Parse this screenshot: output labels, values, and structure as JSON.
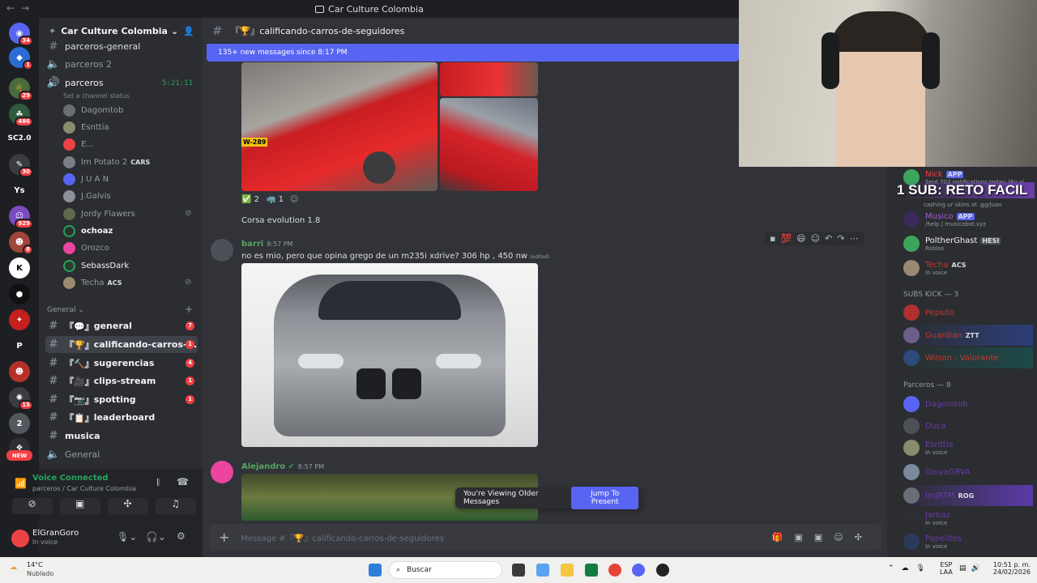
{
  "window": {
    "title": "Car Culture Colombia"
  },
  "server": {
    "name": "Car Culture Colombia"
  },
  "rail_badges": [
    "34",
    "1",
    "29",
    "486",
    "SC2.0",
    "30",
    "Ys",
    "929",
    "8",
    "",
    "P",
    "",
    "15",
    "2",
    "NEW"
  ],
  "channels_top": [
    {
      "name": "parceros-general"
    },
    {
      "name": "parceros 2"
    }
  ],
  "voice_channel": {
    "name": "parceros",
    "timer": "5:21:11",
    "status": "Set a channel status"
  },
  "voice_users": [
    {
      "name": "Dagomtob",
      "tag": ""
    },
    {
      "name": "Esnttia",
      "tag": ""
    },
    {
      "name": "E...",
      "tag": ""
    },
    {
      "name": "Im Potato 2",
      "tag": "CARS"
    },
    {
      "name": "J U A N",
      "tag": ""
    },
    {
      "name": "J.Galvis",
      "tag": ""
    },
    {
      "name": "Jordy Flawers",
      "tag": ""
    },
    {
      "name": "ochoaz",
      "tag": ""
    },
    {
      "name": "Orozco",
      "tag": ""
    },
    {
      "name": "SebassDark",
      "tag": ""
    },
    {
      "name": "Techa",
      "tag": "ACS"
    }
  ],
  "category": "General",
  "channels": [
    {
      "name": "general",
      "prefix": "『💬』",
      "badge": "7"
    },
    {
      "name": "calificando-carros-...",
      "prefix": "『🏆』",
      "badge": "1"
    },
    {
      "name": "sugerencias",
      "prefix": "『🔨』",
      "badge": "4"
    },
    {
      "name": "clips-stream",
      "prefix": "『🎥』",
      "badge": "1"
    },
    {
      "name": "spotting",
      "prefix": "『📷』",
      "badge": "1"
    },
    {
      "name": "leaderboard",
      "prefix": "『📋』",
      "badge": ""
    },
    {
      "name": "musica",
      "prefix": "",
      "badge": ""
    },
    {
      "name": "General",
      "prefix": "",
      "badge": ""
    }
  ],
  "voice_panel": {
    "status": "Voice Connected",
    "location": "parceros / Car Culture Colombia"
  },
  "user": {
    "name": "ElGranGoro",
    "status": "In voice"
  },
  "header": {
    "channel": "『🏆』calificando-carros-de-seguidores"
  },
  "new_messages": "135+ new messages since 8:17 PM",
  "reactions": [
    {
      "emoji": "✅",
      "count": "2"
    },
    {
      "emoji": "🦏",
      "count": "1"
    }
  ],
  "messages": [
    {
      "text": "Corsa evolution 1.8"
    },
    {
      "author": "barri",
      "time": "8:57 PM",
      "text": "no es mio, pero que opina grego de un m235i xdrive? 306 hp , 450 nw",
      "edited": "(edited)"
    },
    {
      "author": "Alejandro",
      "time": "8:57 PM"
    }
  ],
  "plate": "W-289",
  "older_bar": {
    "text": "You're Viewing Older Messages",
    "button": "Jump To Present"
  },
  "composer": {
    "placeholder": "Message #『🏆』calificando-carros-de-seguidores"
  },
  "overlay": {
    "text": "1 SUB: RETO FACIL"
  },
  "members": {
    "top": [
      {
        "name": "Nick",
        "tag": "APP",
        "sub": "Sent 702 notifications today. (Ev yi"
      },
      {
        "name": "",
        "tag": "",
        "sub": "cashing ur skins at .gg/juan"
      },
      {
        "name": "Musico",
        "tag": "APP",
        "sub": "/help | musicobot.xyz"
      },
      {
        "name": "PoltherGhast",
        "tag": "HESI",
        "sub": "Roblox"
      },
      {
        "name": "Techa",
        "tag": "ACS",
        "sub": "In voice"
      }
    ],
    "subs_header": "SUBS KICK — 3",
    "subs": [
      {
        "name": "Pepsito",
        "tag": ""
      },
      {
        "name": "Guardian",
        "tag": "ZTT"
      },
      {
        "name": "Wilson - Valorante",
        "tag": ""
      }
    ],
    "parceros_header": "Parceros — 8",
    "parceros": [
      {
        "name": "Dagomtob",
        "sub": ""
      },
      {
        "name": "Duca",
        "sub": ""
      },
      {
        "name": "Esnttia",
        "sub": "In voice"
      },
      {
        "name": "GiovaGRVA",
        "sub": ""
      },
      {
        "name": "ImJRTM",
        "tag": "ROG",
        "sub": ""
      },
      {
        "name": "Jarbaz",
        "sub": "In voice"
      },
      {
        "name": "Papelitos",
        "sub": "In voice"
      }
    ]
  },
  "taskbar": {
    "weather_temp": "14°C",
    "weather_desc": "Nublado",
    "search": "Buscar",
    "lang": "ESP",
    "lang2": "LAA",
    "time": "10:51 p. m.",
    "date": "24/02/2026"
  },
  "colors": {
    "accent": "#5865f2",
    "badge": "#f23f43",
    "online": "#23a55a",
    "sidebar": "#2b2d31",
    "chat": "#313338"
  }
}
